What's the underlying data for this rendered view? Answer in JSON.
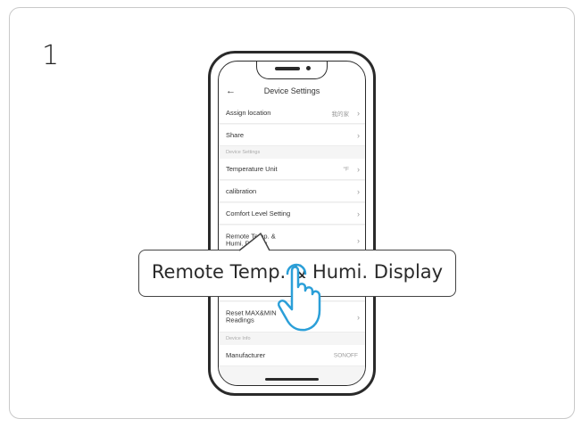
{
  "step": {
    "number": "1"
  },
  "screen": {
    "back_icon": "back-arrow-icon",
    "title": "Device Settings",
    "rows": [
      {
        "label": "Assign location",
        "value": "我的家"
      },
      {
        "label": "Share",
        "value": ""
      },
      {
        "label": "Temperature Unit",
        "value": "°F"
      },
      {
        "label": "calibration",
        "value": ""
      },
      {
        "label": "Comfort Level Setting",
        "value": ""
      },
      {
        "label": "Remote Temp. & Humi. Display",
        "value": ""
      },
      {
        "label": "Reset MAX&MIN Readings",
        "value": ""
      },
      {
        "label": "Manufacturer",
        "value": "SONOFF"
      }
    ],
    "sections": {
      "device_settings": "Device Settings",
      "device_info": "Device Info"
    }
  },
  "callout": {
    "text": "Remote Temp. & Humi. Display"
  },
  "icons": {
    "chevron": "chevron-right-icon",
    "hand": "tap-hand-icon"
  },
  "colors": {
    "hand": "#2b9fd8",
    "outline": "#2a2a2a",
    "card_border": "#c9c9c9"
  }
}
